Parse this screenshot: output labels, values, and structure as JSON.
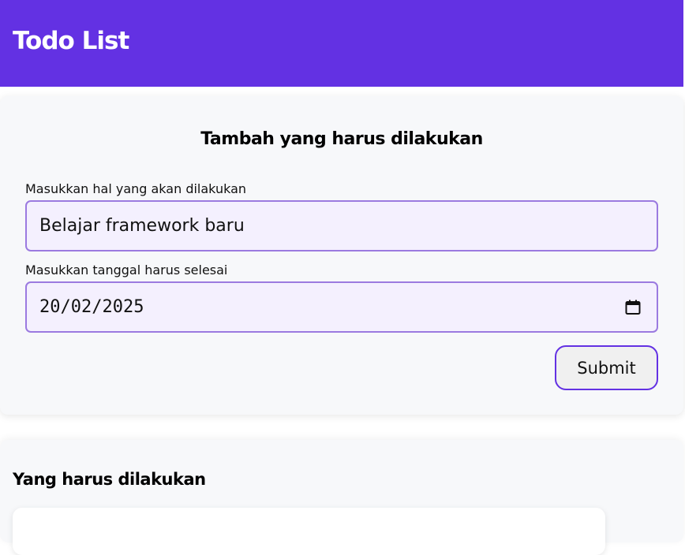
{
  "header": {
    "title": "Todo List",
    "background": "#6331e3"
  },
  "form": {
    "title": "Tambah yang harus dilakukan",
    "todo_label": "Masukkan hal yang akan dilakukan",
    "todo_value": "Belajar framework baru",
    "date_label": "Masukkan tanggal harus selesai",
    "date_value": "20/02/2025",
    "submit_label": "Submit",
    "input_border_color": "#9b7ae0",
    "input_background": "#f4f0fe"
  },
  "list": {
    "title": "Yang harus dilakukan"
  },
  "icons": {
    "date_picker": "calendar-icon"
  }
}
